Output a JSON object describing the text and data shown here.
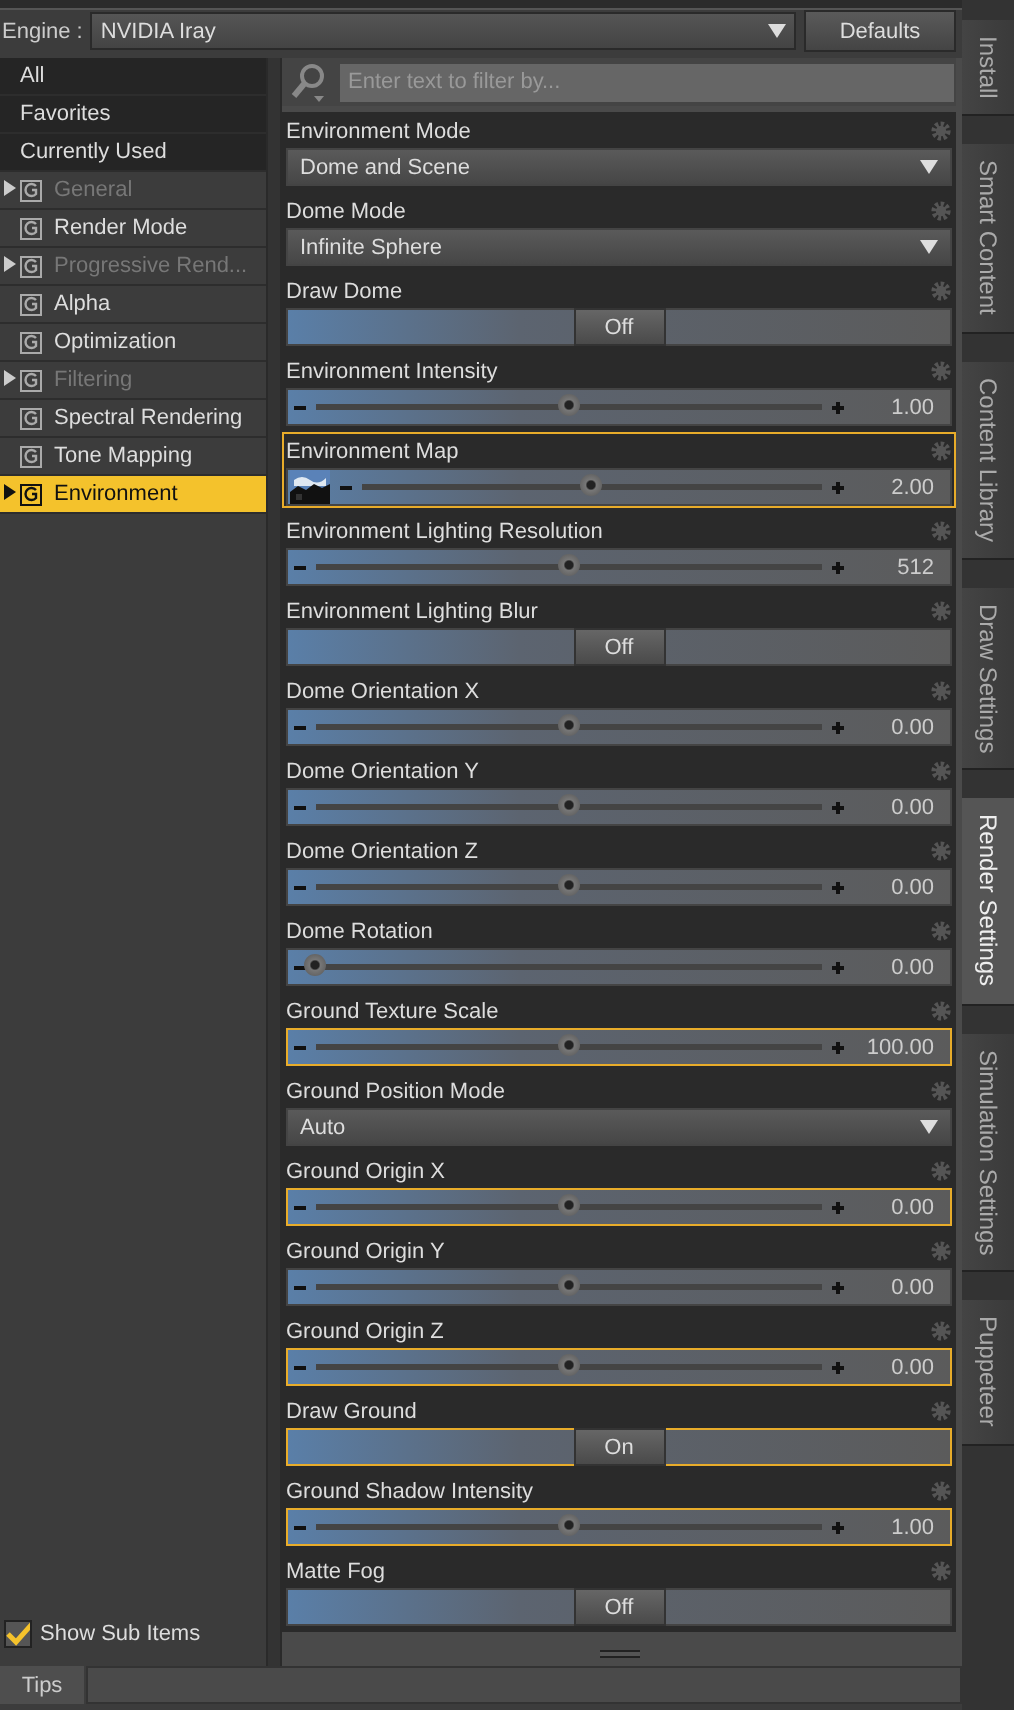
{
  "engine": {
    "label": "Engine :",
    "value": "NVIDIA Iray",
    "button": "Defaults"
  },
  "sidebar": {
    "items": [
      {
        "label": "All",
        "kind": "filter",
        "selected": false
      },
      {
        "label": "Favorites",
        "kind": "filter",
        "selected": false
      },
      {
        "label": "Currently Used",
        "kind": "filter",
        "selected": false
      },
      {
        "label": "General",
        "kind": "group",
        "expandable": true,
        "disabled": true,
        "selected": false
      },
      {
        "label": "Render Mode",
        "kind": "group",
        "expandable": false,
        "disabled": false,
        "selected": false
      },
      {
        "label": "Progressive Rend...",
        "kind": "group",
        "expandable": true,
        "disabled": true,
        "selected": false
      },
      {
        "label": "Alpha",
        "kind": "group",
        "expandable": false,
        "disabled": false,
        "selected": false
      },
      {
        "label": "Optimization",
        "kind": "group",
        "expandable": false,
        "disabled": false,
        "selected": false
      },
      {
        "label": "Filtering",
        "kind": "group",
        "expandable": true,
        "disabled": true,
        "selected": false
      },
      {
        "label": "Spectral Rendering",
        "kind": "group",
        "expandable": false,
        "disabled": false,
        "selected": false
      },
      {
        "label": "Tone Mapping",
        "kind": "group",
        "expandable": false,
        "disabled": false,
        "selected": false
      },
      {
        "label": "Environment",
        "kind": "group",
        "expandable": true,
        "disabled": false,
        "selected": true
      }
    ],
    "show_sub_items": {
      "label": "Show Sub Items",
      "checked": true
    }
  },
  "filter": {
    "placeholder": "Enter text to filter by..."
  },
  "properties": [
    {
      "label": "Environment Mode",
      "kind": "dropdown",
      "value": "Dome and Scene",
      "highlighted": false
    },
    {
      "label": "Dome Mode",
      "kind": "dropdown",
      "value": "Infinite Sphere",
      "highlighted": false
    },
    {
      "label": "Draw Dome",
      "kind": "toggle",
      "value": "Off",
      "highlighted": false
    },
    {
      "label": "Environment Intensity",
      "kind": "slider",
      "level": 0.5,
      "value": "1.00",
      "highlighted": false
    },
    {
      "label": "Environment Map",
      "kind": "map",
      "level": 0.5,
      "value": "2.00",
      "highlighted": true
    },
    {
      "label": "Environment Lighting Resolution",
      "kind": "slider",
      "level": 0.5,
      "value": "512",
      "highlighted": false
    },
    {
      "label": "Environment Lighting Blur",
      "kind": "toggle",
      "value": "Off",
      "highlighted": false
    },
    {
      "label": "Dome Orientation X",
      "kind": "slider",
      "level": 0.5,
      "value": "0.00",
      "highlighted": false
    },
    {
      "label": "Dome Orientation Y",
      "kind": "slider",
      "level": 0.5,
      "value": "0.00",
      "highlighted": false
    },
    {
      "label": "Dome Orientation Z",
      "kind": "slider",
      "level": 0.5,
      "value": "0.00",
      "highlighted": false
    },
    {
      "label": "Dome Rotation",
      "kind": "slider",
      "level": 0.0,
      "value": "0.00",
      "highlighted": false
    },
    {
      "label": "Ground Texture Scale",
      "kind": "slider",
      "level": 0.5,
      "value": "100.00",
      "highlighted": true
    },
    {
      "label": "Ground Position Mode",
      "kind": "dropdown",
      "value": "Auto",
      "highlighted": false
    },
    {
      "label": "Ground Origin X",
      "kind": "slider",
      "level": 0.5,
      "value": "0.00",
      "highlighted": true
    },
    {
      "label": "Ground Origin Y",
      "kind": "slider",
      "level": 0.5,
      "value": "0.00",
      "highlighted": false
    },
    {
      "label": "Ground Origin Z",
      "kind": "slider",
      "level": 0.5,
      "value": "0.00",
      "highlighted": true
    },
    {
      "label": "Draw Ground",
      "kind": "toggle",
      "value": "On",
      "highlighted": true
    },
    {
      "label": "Ground Shadow Intensity",
      "kind": "slider",
      "level": 0.5,
      "value": "1.00",
      "highlighted": true
    },
    {
      "label": "Matte Fog",
      "kind": "toggle",
      "value": "Off",
      "highlighted": false
    }
  ],
  "side_tabs": [
    {
      "label": "Install",
      "selected": false
    },
    {
      "label": "Smart Content",
      "selected": false
    },
    {
      "label": "Content Library",
      "selected": false
    },
    {
      "label": "Draw Settings",
      "selected": false
    },
    {
      "label": "Render Settings",
      "selected": true
    },
    {
      "label": "Simulation Settings",
      "selected": false
    },
    {
      "label": "Puppeteer",
      "selected": false
    }
  ],
  "bottom_bar": {
    "tab": "Tips"
  }
}
